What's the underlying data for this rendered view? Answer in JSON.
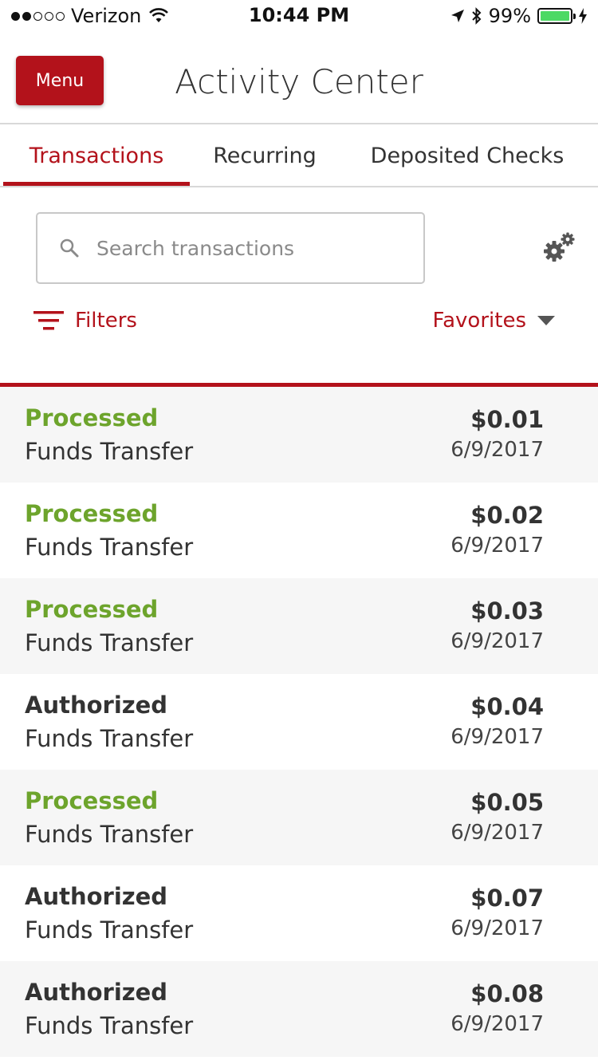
{
  "status_bar": {
    "carrier": "Verizon",
    "time": "10:44 PM",
    "battery": "99%",
    "battery_level": 0.99,
    "signal_bars": 2,
    "icons": [
      "wifi-icon",
      "location-arrow-icon",
      "bluetooth-icon",
      "charging-icon"
    ]
  },
  "header": {
    "menu_label": "Menu",
    "title": "Activity Center"
  },
  "tabs": [
    {
      "label": "Transactions",
      "active": true
    },
    {
      "label": "Recurring",
      "active": false
    },
    {
      "label": "Deposited Checks",
      "active": false
    }
  ],
  "search": {
    "placeholder": "Search transactions",
    "value": ""
  },
  "toolbar": {
    "filters_label": "Filters",
    "favorites_label": "Favorites"
  },
  "colors": {
    "brand": "#b3121b",
    "processed": "#6da42c",
    "authorized": "#333333"
  },
  "transactions": [
    {
      "status": "Processed",
      "description": "Funds Transfer",
      "amount": "$0.01",
      "date": "6/9/2017"
    },
    {
      "status": "Processed",
      "description": "Funds Transfer",
      "amount": "$0.02",
      "date": "6/9/2017"
    },
    {
      "status": "Processed",
      "description": "Funds Transfer",
      "amount": "$0.03",
      "date": "6/9/2017"
    },
    {
      "status": "Authorized",
      "description": "Funds Transfer",
      "amount": "$0.04",
      "date": "6/9/2017"
    },
    {
      "status": "Processed",
      "description": "Funds Transfer",
      "amount": "$0.05",
      "date": "6/9/2017"
    },
    {
      "status": "Authorized",
      "description": "Funds Transfer",
      "amount": "$0.07",
      "date": "6/9/2017"
    },
    {
      "status": "Authorized",
      "description": "Funds Transfer",
      "amount": "$0.08",
      "date": "6/9/2017"
    }
  ]
}
